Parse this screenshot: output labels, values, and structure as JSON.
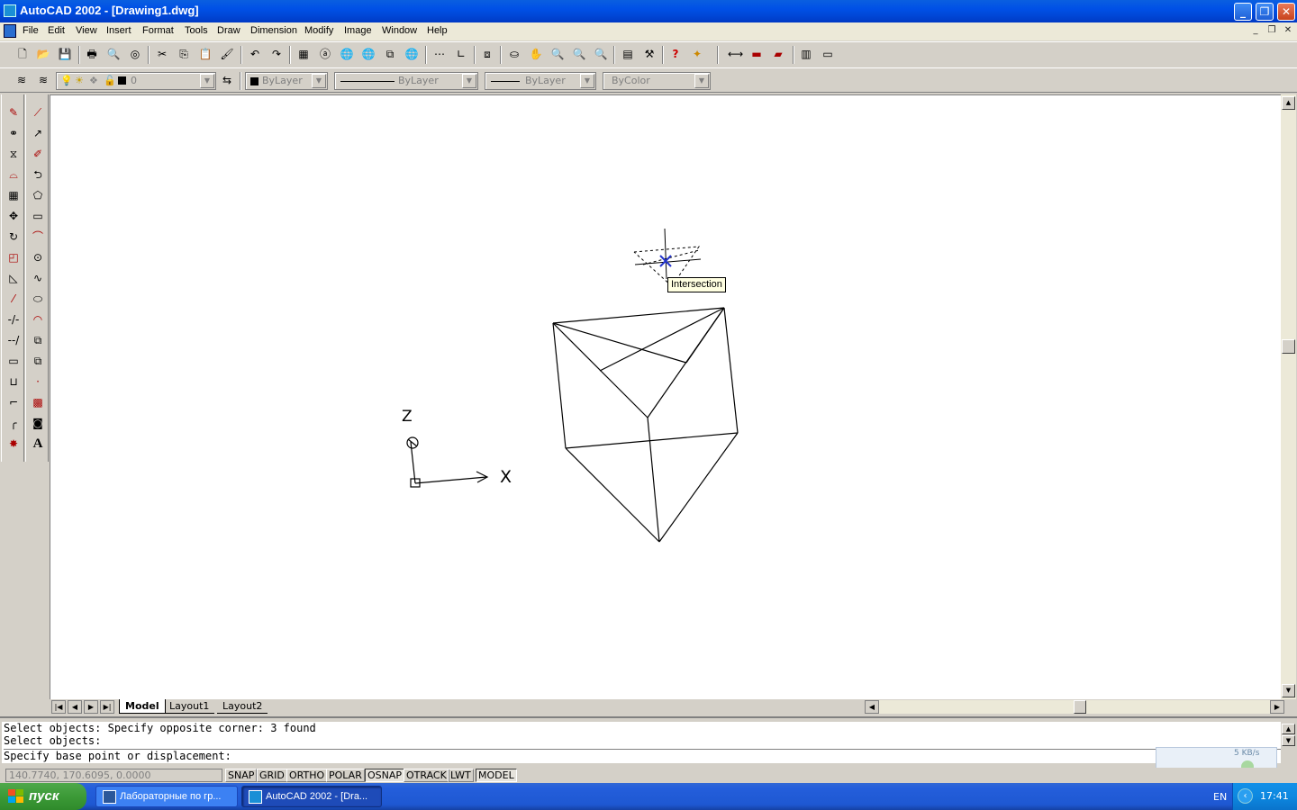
{
  "window": {
    "title": "AutoCAD 2002 - [Drawing1.dwg]",
    "controls": {
      "minimize": "_",
      "maximize": "❐",
      "close": "✕"
    }
  },
  "menu": [
    "File",
    "Edit",
    "View",
    "Insert",
    "Format",
    "Tools",
    "Draw",
    "Dimension",
    "Modify",
    "Image",
    "Window",
    "Help"
  ],
  "mdi_controls": [
    "_",
    "❐",
    "✕"
  ],
  "properties_bar": {
    "layer_value": "0",
    "color_value": "ByLayer",
    "linetype_value": "ByLayer",
    "lineweight_value": "ByLayer",
    "plotstyle_value": "ByColor"
  },
  "canvas": {
    "tooltip": "Intersection",
    "ucs_x_label": "X",
    "ucs_z_label": "Z"
  },
  "layout_tabs": [
    "Model",
    "Layout1",
    "Layout2"
  ],
  "command_window": {
    "lines": [
      "Select objects: Specify opposite corner: 3 found",
      "Select objects:"
    ],
    "prompt": "Specify base point or displacement:"
  },
  "status": {
    "coordinates": "140.7740, 170.6095, 0.0000",
    "buttons": [
      {
        "label": "SNAP",
        "on": false
      },
      {
        "label": "GRID",
        "on": false
      },
      {
        "label": "ORTHO",
        "on": false
      },
      {
        "label": "POLAR",
        "on": false
      },
      {
        "label": "OSNAP",
        "on": true
      },
      {
        "label": "OTRACK",
        "on": false
      },
      {
        "label": "LWT",
        "on": false
      },
      {
        "label": "MODEL",
        "on": true
      }
    ],
    "net_rate": "5 KB/s"
  },
  "taskbar": {
    "start_label": "пуск",
    "items": [
      {
        "label": "Лабораторные по гр...",
        "active": false
      },
      {
        "label": "AutoCAD 2002 - [Dra...",
        "active": true
      }
    ],
    "language": "EN",
    "clock": "17:41"
  },
  "colors": {
    "title_bar": "#0050e6",
    "start_button": "#3c9a37",
    "taskbar": "#245edb",
    "tooltip_bg": "#ffffe1",
    "osnap_marker": "#2233cc"
  }
}
